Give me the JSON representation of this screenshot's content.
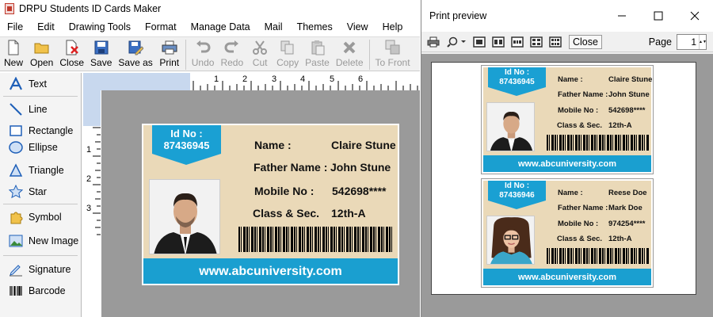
{
  "app": {
    "title": "DRPU Students ID Cards Maker"
  },
  "menu": [
    "File",
    "Edit",
    "Drawing Tools",
    "Format",
    "Manage Data",
    "Mail",
    "Themes",
    "View",
    "Help"
  ],
  "toolbar": {
    "new": "New",
    "open": "Open",
    "close": "Close",
    "save": "Save",
    "save_as": "Save as",
    "print": "Print",
    "undo": "Undo",
    "redo": "Redo",
    "cut": "Cut",
    "copy": "Copy",
    "paste": "Paste",
    "delete": "Delete",
    "to_front": "To Front"
  },
  "tools": {
    "text": "Text",
    "line": "Line",
    "rectangle": "Rectangle",
    "ellipse": "Ellipse",
    "triangle": "Triangle",
    "star": "Star",
    "symbol": "Symbol",
    "new_image": "New Image",
    "signature": "Signature",
    "barcode": "Barcode"
  },
  "ruler": {
    "top": [
      "1",
      "2",
      "3",
      "4",
      "5",
      "6"
    ],
    "left": [
      "1",
      "2",
      "3"
    ]
  },
  "card_main": {
    "id_label": "Id No :",
    "id_value": "87436945",
    "name_label": "Name :",
    "name_value": "Claire Stune",
    "father_label": "Father Name :",
    "father_value": "John Stune",
    "mobile_label": "Mobile No :",
    "mobile_value": "542698****",
    "class_label": "Class & Sec.",
    "class_value": "12th-A",
    "website": "www.abcuniversity.com"
  },
  "preview": {
    "title": "Print preview",
    "close_button": "Close",
    "page_label": "Page",
    "page_value": "1",
    "cards": [
      {
        "id_label": "Id No :",
        "id_value": "87436945",
        "name_label": "Name :",
        "name_value": "Claire Stune",
        "father_label": "Father Name :",
        "father_value": "John Stune",
        "mobile_label": "Mobile No :",
        "mobile_value": "542698****",
        "class_label": "Class & Sec.",
        "class_value": "12th-A",
        "website": "www.abcuniversity.com"
      },
      {
        "id_label": "Id No :",
        "id_value": "87436946",
        "name_label": "Name :",
        "name_value": "Reese Doe",
        "father_label": "Father Name :",
        "father_value": "Mark Doe",
        "mobile_label": "Mobile No :",
        "mobile_value": "974254****",
        "class_label": "Class & Sec.",
        "class_value": "12th-A",
        "website": "www.abcuniversity.com"
      }
    ]
  },
  "colors": {
    "accent": "#1aa0d3",
    "card_bg": "#ead9b8",
    "ruler": "#c8d8ee",
    "canvas": "#9a9a9a"
  }
}
